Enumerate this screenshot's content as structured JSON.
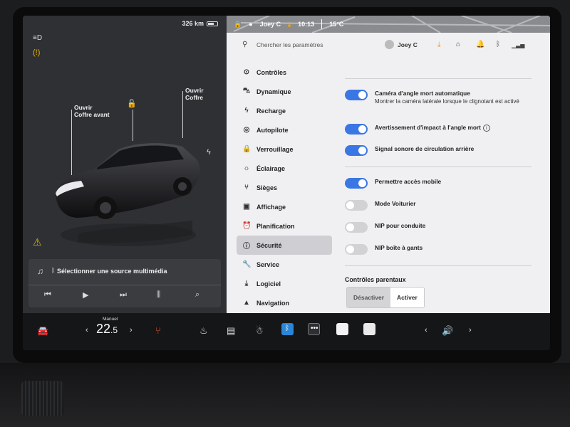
{
  "status": {
    "range": "326 km",
    "user": "Joey C",
    "time": "10:13",
    "temp": "15°C"
  },
  "car": {
    "frunk_label_1": "Ouvrir",
    "frunk_label_2": "Coffre avant",
    "trunk_label_1": "Ouvrir",
    "trunk_label_2": "Coffre"
  },
  "media": {
    "source_text": "Sélectionner une source multimédia"
  },
  "search": {
    "placeholder": "Chercher les paramètres"
  },
  "header": {
    "user": "Joey C"
  },
  "nav": [
    {
      "label": "Contrôles",
      "icon": "toggle-icon",
      "glyph": "⊙"
    },
    {
      "label": "Dynamique",
      "icon": "car-icon",
      "glyph": "⛍"
    },
    {
      "label": "Recharge",
      "icon": "bolt-icon",
      "glyph": "ϟ"
    },
    {
      "label": "Autopilote",
      "icon": "steering-wheel-icon",
      "glyph": "◎"
    },
    {
      "label": "Verrouillage",
      "icon": "lock-icon",
      "glyph": "🔒"
    },
    {
      "label": "Éclairage",
      "icon": "sun-icon",
      "glyph": "☼"
    },
    {
      "label": "Sièges",
      "icon": "seat-icon",
      "glyph": "⑂"
    },
    {
      "label": "Affichage",
      "icon": "display-icon",
      "glyph": "▣"
    },
    {
      "label": "Planification",
      "icon": "alarm-clock-icon",
      "glyph": "⏰"
    },
    {
      "label": "Sécurité",
      "icon": "info-icon",
      "glyph": "ⓘ"
    },
    {
      "label": "Service",
      "icon": "wrench-icon",
      "glyph": "🔧"
    },
    {
      "label": "Logiciel",
      "icon": "download-icon",
      "glyph": "⤓"
    },
    {
      "label": "Navigation",
      "icon": "navigation-arrow-icon",
      "glyph": "▲"
    }
  ],
  "active_nav": "Sécurité",
  "settings": {
    "blind_spot_camera": {
      "label": "Caméra d'angle mort automatique",
      "sub": "Montrer la caméra latérale lorsque le clignotant est activé",
      "on": true
    },
    "blind_spot_warning": {
      "label": "Avertissement d'impact à l'angle mort",
      "on": true
    },
    "rear_cross_traffic": {
      "label": "Signal sonore de circulation arrière",
      "on": true
    },
    "mobile_access": {
      "label": "Permettre accès mobile",
      "on": true
    },
    "valet_mode": {
      "label": "Mode Voiturier",
      "on": false
    },
    "pin_to_drive": {
      "label": "NIP pour conduite",
      "on": false
    },
    "glovebox_pin": {
      "label": "NIP boîte à gants",
      "on": false
    }
  },
  "parental": {
    "title": "Contrôles parentaux",
    "disable": "Désactiver",
    "enable": "Activer",
    "selected": "Désactiver"
  },
  "bottom": {
    "temp_mode": "Manuel",
    "temp_int": "22",
    "temp_dec": ".5"
  },
  "colors": {
    "accent": "#3a77e4",
    "bottom_bar": "#151617",
    "settings_bg": "#f0f0f2"
  }
}
